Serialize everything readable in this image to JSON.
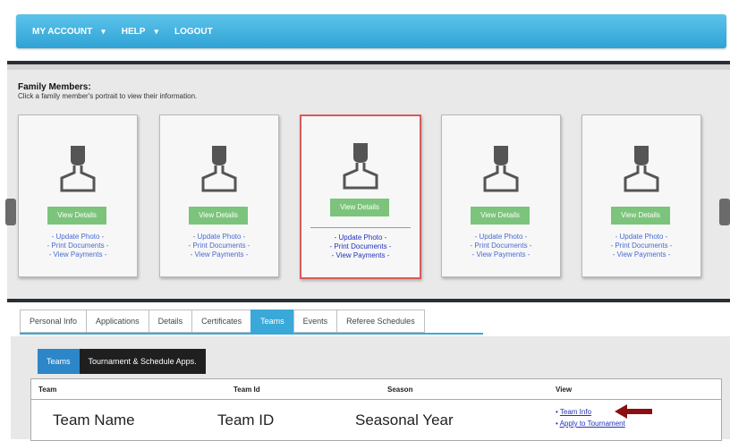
{
  "nav": {
    "my_account": "MY ACCOUNT",
    "help": "HELP",
    "logout": "LOGOUT"
  },
  "family": {
    "title": "Family Members:",
    "subtitle": "Click a family member's portrait to view their information.",
    "cards": [
      {
        "btn": "View Details",
        "l1": "- Update Photo -",
        "l2": "- Print Documents -",
        "l3": "- View Payments -"
      },
      {
        "btn": "View Details",
        "l1": "- Update Photo -",
        "l2": "- Print Documents -",
        "l3": "- View Payments -"
      },
      {
        "btn": "View Details",
        "l1": "- Update Photo -",
        "l2": "- Print Documents -",
        "l3": "- View Payments -"
      },
      {
        "btn": "View Details",
        "l1": "- Update Photo -",
        "l2": "- Print Documents -",
        "l3": "- View Payments -"
      },
      {
        "btn": "View Details",
        "l1": "- Update Photo -",
        "l2": "- Print Documents -",
        "l3": "- View Payments -"
      }
    ]
  },
  "tabs": [
    "Personal Info",
    "Applications",
    "Details",
    "Certificates",
    "Teams",
    "Events",
    "Referee Schedules"
  ],
  "subtabs": [
    "Teams",
    "Tournament & Schedule Apps."
  ],
  "table": {
    "headers": [
      "Team",
      "Team Id",
      "Season",
      "View"
    ],
    "row": {
      "team": "Team Name",
      "team_id": "Team ID",
      "season": "Seasonal Year"
    },
    "links": [
      "Team Info",
      "Apply to Tournament"
    ]
  },
  "colors": {
    "nav_blue": "#2fa3d6",
    "active_tab": "#3aa8d8",
    "view_details_green": "#7cc47b",
    "active_card_border": "#d65a5a",
    "arrow_red": "#8b0e12"
  }
}
